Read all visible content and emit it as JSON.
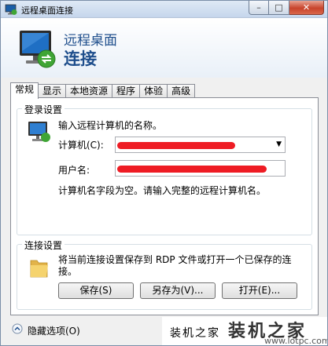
{
  "window": {
    "title": "远程桌面连接",
    "caption_min": "–",
    "caption_max": "□",
    "caption_close": "✕"
  },
  "header": {
    "line1": "远程桌面",
    "line2": "连接",
    "icon": "remote-desktop-monitor-icon"
  },
  "tabs": [
    {
      "label": "常规",
      "active": true
    },
    {
      "label": "显示",
      "active": false
    },
    {
      "label": "本地资源",
      "active": false
    },
    {
      "label": "程序",
      "active": false
    },
    {
      "label": "体验",
      "active": false
    },
    {
      "label": "高级",
      "active": false
    }
  ],
  "login": {
    "group_title": "登录设置",
    "prompt": "输入远程计算机的名称。",
    "computer_label": "计算机(C):",
    "computer_value": "",
    "username_label": "用户名:",
    "username_value": "",
    "hint": "计算机名字段为空。请输入完整的远程计算机名。",
    "icon": "computer-monitor-icon"
  },
  "connection": {
    "group_title": "连接设置",
    "description": "将当前连接设置保存到 RDP 文件或打开一个已保存的连接。",
    "save_label": "保存(S)",
    "save_as_label": "另存为(V)...",
    "open_label": "打开(E)...",
    "icon": "folder-icon"
  },
  "footer": {
    "hide_options_label": "隐藏选项(O)"
  },
  "watermark": {
    "small": "装机之家",
    "big": "装机之家",
    "url": "www.lotpc.com"
  },
  "colors": {
    "header_text": "#1e4e8c",
    "redaction": "#ee1c24"
  }
}
